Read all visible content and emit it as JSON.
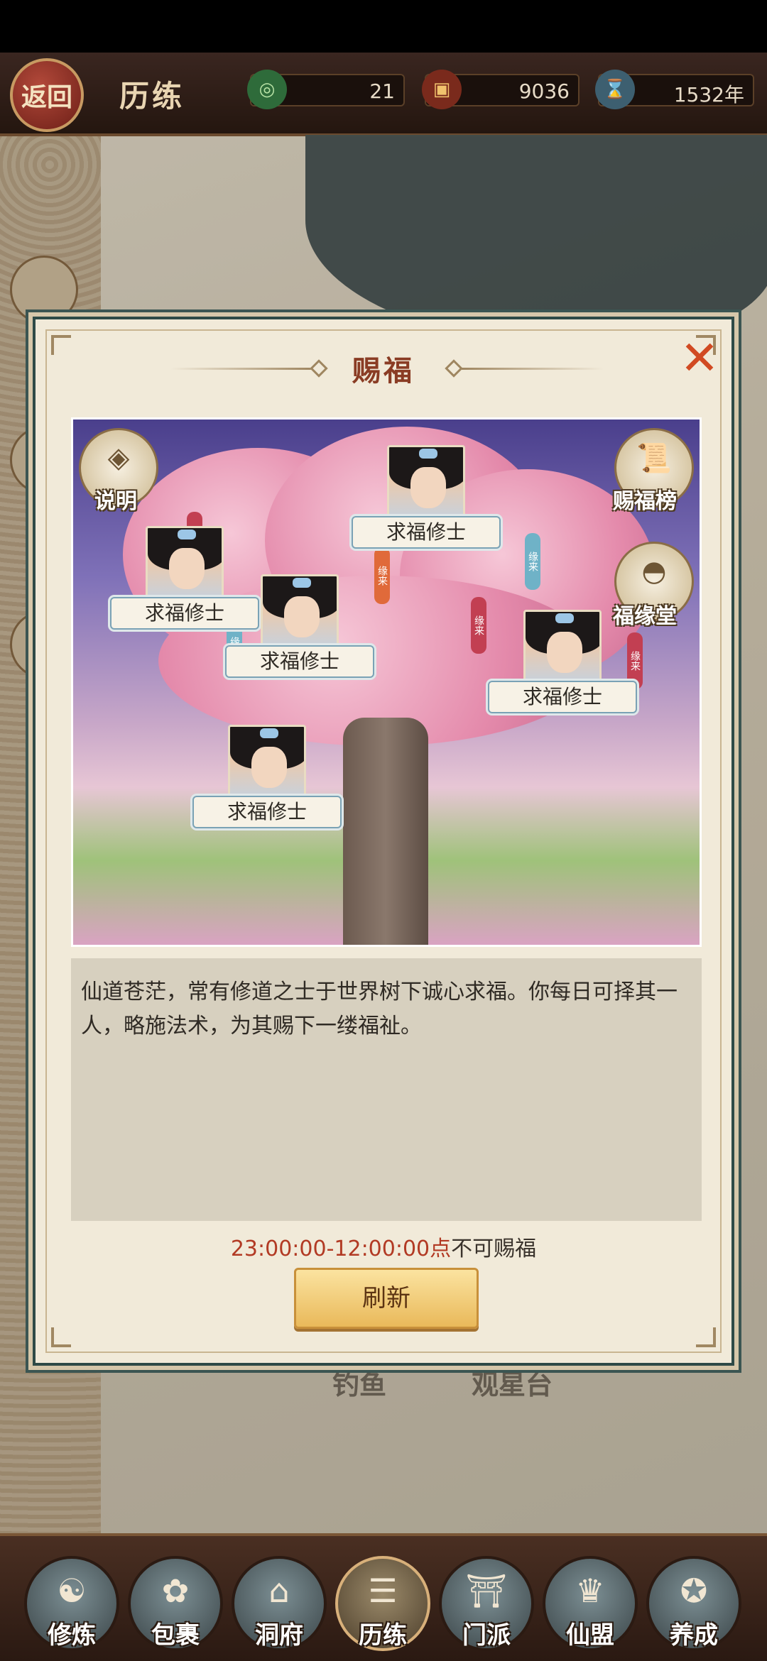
{
  "header": {
    "back_label": "返回",
    "title": "历练",
    "resources": [
      {
        "icon": "jade-swirl-icon",
        "value": "21"
      },
      {
        "icon": "treasure-chest-icon",
        "value": "9036"
      },
      {
        "icon": "hourglass-icon",
        "value": "1532年"
      }
    ]
  },
  "map": {
    "labels": [
      "钓鱼",
      "观星台"
    ]
  },
  "modal": {
    "title": "赐福",
    "close_icon": "close-x-icon",
    "scene_buttons": {
      "explain": "说明",
      "ranking": "赐福榜",
      "hall": "福缘堂"
    },
    "seekers": [
      {
        "name": "求福修士"
      },
      {
        "name": "求福修士"
      },
      {
        "name": "求福修士"
      },
      {
        "name": "求福修士"
      },
      {
        "name": "求福修士"
      }
    ],
    "lantern_text": "缘来",
    "description": "仙道苍茫，常有修道之士于世界树下诚心求福。你每日可择其一人，略施法术，为其赐下一缕福祉。",
    "time_range": "23:00:00-12:00:00点",
    "time_suffix": "不可赐福",
    "refresh_label": "刷新"
  },
  "bottom_nav": [
    {
      "label": "修炼",
      "icon": "cultivator-icon"
    },
    {
      "label": "包裹",
      "icon": "bag-icon"
    },
    {
      "label": "洞府",
      "icon": "cave-house-icon"
    },
    {
      "label": "历练",
      "icon": "scroll-icon",
      "active": true
    },
    {
      "label": "门派",
      "icon": "sect-gate-icon"
    },
    {
      "label": "仙盟",
      "icon": "alliance-icon"
    },
    {
      "label": "养成",
      "icon": "pentagram-icon"
    }
  ],
  "colors": {
    "accent_red": "#b23a24",
    "title_brown": "#8a3c24",
    "button_gold": "#e9b95a"
  }
}
